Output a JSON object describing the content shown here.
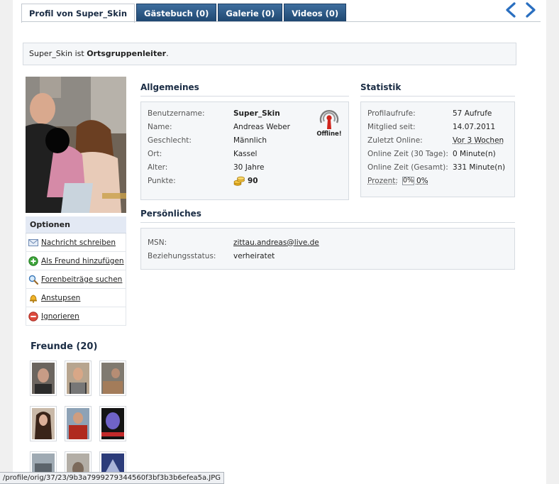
{
  "tabs": [
    {
      "label": "Profil von Super_Skin",
      "active": true
    },
    {
      "label": "Gästebuch (0)",
      "active": false
    },
    {
      "label": "Galerie (0)",
      "active": false
    },
    {
      "label": "Videos (0)",
      "active": false
    }
  ],
  "rank": {
    "user": "Super_Skin",
    "middle": " ist ",
    "title": "Ortsgruppenleiter",
    "end": "."
  },
  "options": {
    "title": "Optionen",
    "items": [
      {
        "label": "Nachricht schreiben",
        "icon": "envelope-icon"
      },
      {
        "label": "Als Freund hinzufügen",
        "icon": "add-icon"
      },
      {
        "label": "Forenbeiträge suchen",
        "icon": "search-icon"
      },
      {
        "label": "Anstupsen",
        "icon": "bell-icon"
      },
      {
        "label": "Ignorieren",
        "icon": "block-icon"
      }
    ]
  },
  "friends": {
    "title": "Freunde (20)"
  },
  "general": {
    "title": "Allgemeines",
    "rows": [
      {
        "key": "Benutzername:",
        "value": "Super_Skin"
      },
      {
        "key": "Name:",
        "value": "Andreas Weber"
      },
      {
        "key": "Geschlecht:",
        "value": "Männlich"
      },
      {
        "key": "Ort:",
        "value": "Kassel"
      },
      {
        "key": "Alter:",
        "value": "30 Jahre"
      },
      {
        "key": "Punkte:",
        "value": "90"
      }
    ],
    "status": "Offline!"
  },
  "stats": {
    "title": "Statistik",
    "rows": [
      {
        "key": "Profilaufrufe:",
        "value": "57 Aufrufe"
      },
      {
        "key": "Mitglied seit:",
        "value": "14.07.2011"
      },
      {
        "key": "Zuletzt Online:",
        "value": "Vor 3 Wochen"
      },
      {
        "key": "Online Zeit (30 Tage):",
        "value": "0 Minute(n)"
      },
      {
        "key": "Online Zeit (Gesamt):",
        "value": "331 Minute(n)"
      }
    ],
    "percent_label": "Prozent:",
    "percent_value": "0%",
    "percent_text": "0%"
  },
  "personal": {
    "title": "Persönliches",
    "rows": [
      {
        "key": "MSN:",
        "value": "zittau.andreas@live.de"
      },
      {
        "key": "Beziehungsstatus:",
        "value": "verheiratet"
      }
    ]
  },
  "statusbar": "/profile/orig/37/23/9b3a7999279344560f3bf3b3b6efea5a.JPG",
  "colors": {
    "tab_bg": "#1e466f",
    "title": "#1a2c44",
    "box_bg": "#f5f7f9"
  }
}
